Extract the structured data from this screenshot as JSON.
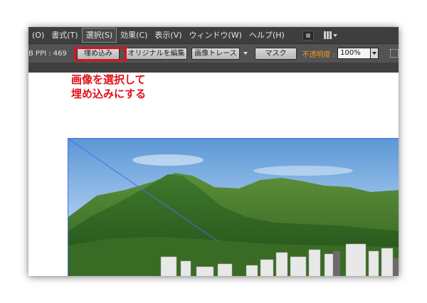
{
  "menubar": {
    "items": [
      {
        "label": "(O)"
      },
      {
        "label": "書式(T)"
      },
      {
        "label": "選択(S)",
        "active": true
      },
      {
        "label": "効果(C)"
      },
      {
        "label": "表示(V)"
      },
      {
        "label": "ウィンドウ(W)"
      },
      {
        "label": "ヘルプ(H)"
      }
    ],
    "icons": [
      "bridge-icon",
      "arrange-documents-icon"
    ]
  },
  "options_bar": {
    "ppi_text": "B PPI : 469",
    "embed_button": "埋め込み",
    "edit_original_button": "オリジナルを編集",
    "image_trace_button": "画像トレース",
    "mask_button": "マスク",
    "opacity_label": "不透明度 :",
    "opacity_value": "100%"
  },
  "annotation": {
    "line1": "画像を選択して",
    "line2": "埋め込みにする",
    "color": "#e0101a"
  },
  "colors": {
    "menubar_bg": "#3e3e3e",
    "optionsbar_bg": "#535353",
    "highlight": "#e0101a",
    "selection": "#4a6cf0",
    "opacity_label": "#f09a1c"
  }
}
